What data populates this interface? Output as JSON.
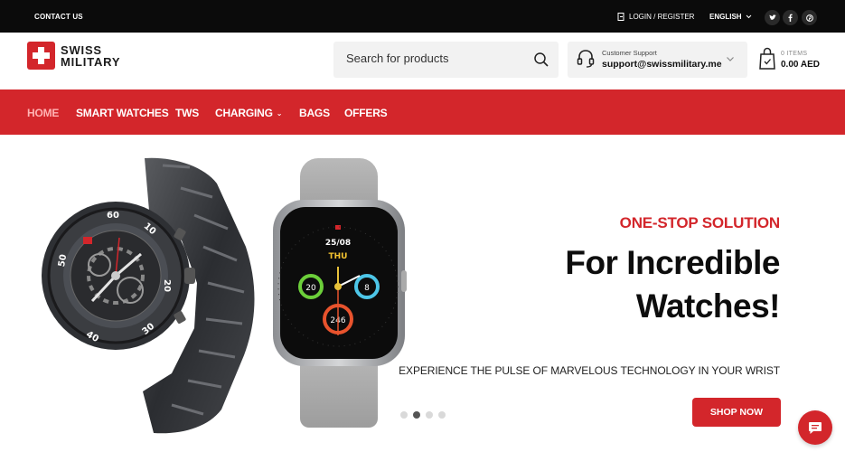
{
  "topbar": {
    "contact": "CONTACT US",
    "login": "LOGIN / REGISTER",
    "language": "ENGLISH",
    "social": [
      "twitter-icon",
      "facebook-icon",
      "pinterest-icon"
    ]
  },
  "header": {
    "logo_line1": "SWISS",
    "logo_line2": "MILITARY",
    "search_placeholder": "Search for products",
    "support_label": "Customer Support",
    "support_email": "support@swissmilitary.me",
    "cart_items": "0 ITEMS",
    "cart_total": "0.00 AED"
  },
  "nav": {
    "items": [
      {
        "label": "HOME",
        "active": true
      },
      {
        "label": "SMART WATCHES"
      },
      {
        "label": "TWS"
      },
      {
        "label": "CHARGING",
        "has_dropdown": true
      },
      {
        "label": "BAGS"
      },
      {
        "label": "OFFERS"
      }
    ]
  },
  "hero": {
    "kicker": "ONE-STOP SOLUTION",
    "headline_line1": "For Incredible",
    "headline_line2": "Watches!",
    "subline": "EXPERIENCE THE PULSE OF MARVELOUS TECHNOLOGY IN YOUR WRIST",
    "button": "SHOP NOW",
    "slide_count": 4,
    "active_slide": 2,
    "watch_display": {
      "date": "25/08",
      "day": "THU",
      "metric_left": "20",
      "metric_right": "8",
      "metric_bottom": "246",
      "bezel_numbers": [
        "60",
        "10",
        "20",
        "30",
        "40",
        "50"
      ]
    }
  },
  "colors": {
    "brand_red": "#d3262b",
    "topbar": "#0b0b0b",
    "text_dark": "#0d0d0d"
  }
}
